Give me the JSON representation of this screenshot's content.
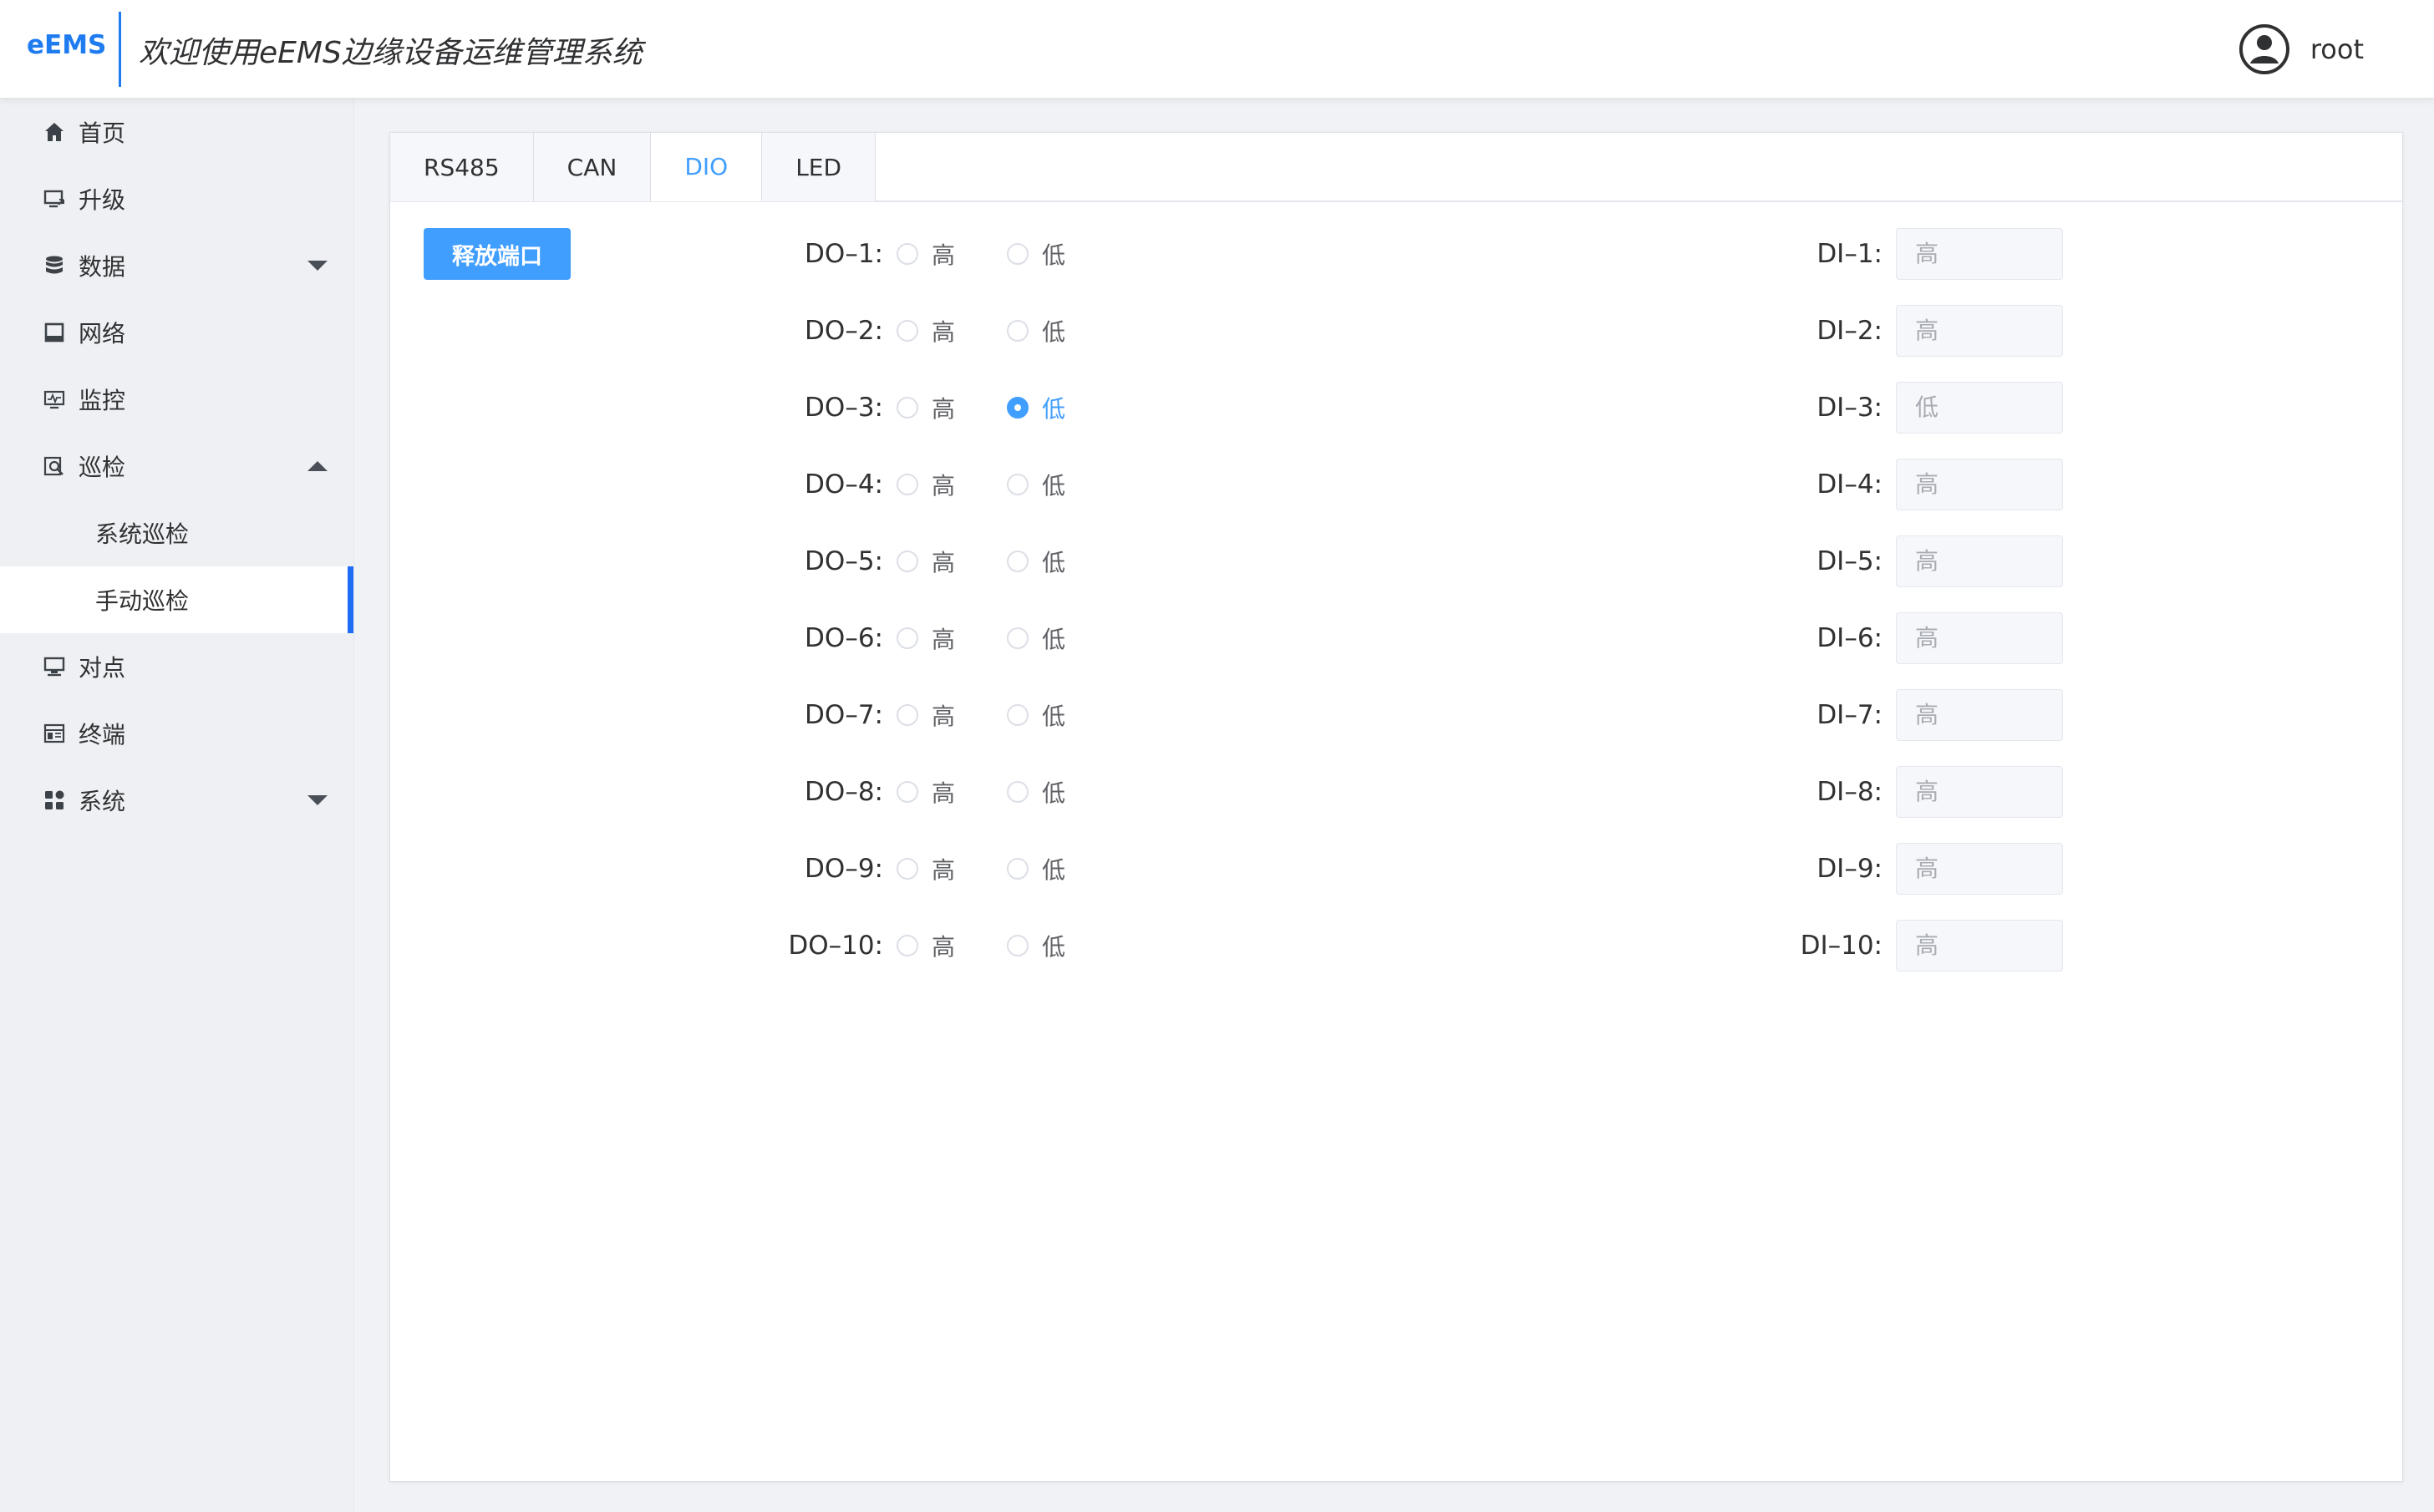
{
  "header": {
    "logo": "eEMS",
    "title": "欢迎使用eEMS边缘设备运维管理系统",
    "user": "root"
  },
  "sidebar": {
    "items": [
      {
        "label": "首页",
        "icon": "home-icon"
      },
      {
        "label": "升级",
        "icon": "upgrade-icon"
      },
      {
        "label": "数据",
        "icon": "database-icon",
        "arrow": "down"
      },
      {
        "label": "网络",
        "icon": "network-icon"
      },
      {
        "label": "监控",
        "icon": "monitor-icon"
      },
      {
        "label": "巡检",
        "icon": "inspect-icon",
        "arrow": "up"
      },
      {
        "label": "对点",
        "icon": "point-icon"
      },
      {
        "label": "终端",
        "icon": "terminal-icon"
      },
      {
        "label": "系统",
        "icon": "system-icon",
        "arrow": "down"
      }
    ],
    "submenu": [
      {
        "label": "系统巡检",
        "active": false
      },
      {
        "label": "手动巡检",
        "active": true
      }
    ]
  },
  "tabs": [
    {
      "label": "RS485",
      "active": false
    },
    {
      "label": "CAN",
      "active": false
    },
    {
      "label": "DIO",
      "active": true
    },
    {
      "label": "LED",
      "active": false
    }
  ],
  "release_button": "释放端口",
  "radio_labels": {
    "high": "高",
    "low": "低"
  },
  "do_ports": [
    {
      "label": "DO–1:",
      "selected": ""
    },
    {
      "label": "DO–2:",
      "selected": ""
    },
    {
      "label": "DO–3:",
      "selected": "low"
    },
    {
      "label": "DO–4:",
      "selected": ""
    },
    {
      "label": "DO–5:",
      "selected": ""
    },
    {
      "label": "DO–6:",
      "selected": ""
    },
    {
      "label": "DO–7:",
      "selected": ""
    },
    {
      "label": "DO–8:",
      "selected": ""
    },
    {
      "label": "DO–9:",
      "selected": ""
    },
    {
      "label": "DO–10:",
      "selected": ""
    }
  ],
  "di_ports": [
    {
      "label": "DI–1:",
      "value": "高"
    },
    {
      "label": "DI–2:",
      "value": "高"
    },
    {
      "label": "DI–3:",
      "value": "低"
    },
    {
      "label": "DI–4:",
      "value": "高"
    },
    {
      "label": "DI–5:",
      "value": "高"
    },
    {
      "label": "DI–6:",
      "value": "高"
    },
    {
      "label": "DI–7:",
      "value": "高"
    },
    {
      "label": "DI–8:",
      "value": "高"
    },
    {
      "label": "DI–9:",
      "value": "高"
    },
    {
      "label": "DI–10:",
      "value": "高"
    }
  ],
  "colors": {
    "accent": "#409eff",
    "sidebar_bg": "#eef0f3",
    "active_bar": "#1f6cf5"
  }
}
